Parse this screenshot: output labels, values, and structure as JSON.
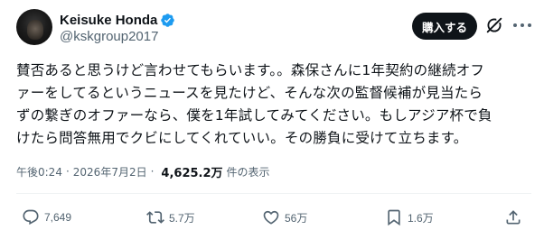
{
  "author": {
    "display_name": "Keisuke Honda",
    "handle": "@kskgroup2017",
    "verified": true
  },
  "header": {
    "subscribe_label": "購入する"
  },
  "post": {
    "lines": [
      "賛否あると思うけど言わせてもらいます。。森保さんに1年契約の継続オフ",
      "ァーをしてるというニュースを見たけど、そんな次の監督候補が見当たら",
      "ずの繋ぎのオファーなら、僕を1年試してみてください。もしアジア杯で負",
      "けたら問答無用でクビにしてくれていい。その勝負に受けて立ちます。"
    ]
  },
  "meta": {
    "time": "午後0:24",
    "separator": "·",
    "date": "2026年7月2日",
    "views": "4,625.2万",
    "views_label": "件の表示"
  },
  "actions": {
    "replies": "7,649",
    "reposts": "5.7万",
    "likes": "56万",
    "bookmarks": "1.6万"
  },
  "colors": {
    "verified_badge": "#1d9bf0",
    "text_primary": "#0f1419",
    "text_secondary": "#536471",
    "button_bg": "#0f1419"
  }
}
